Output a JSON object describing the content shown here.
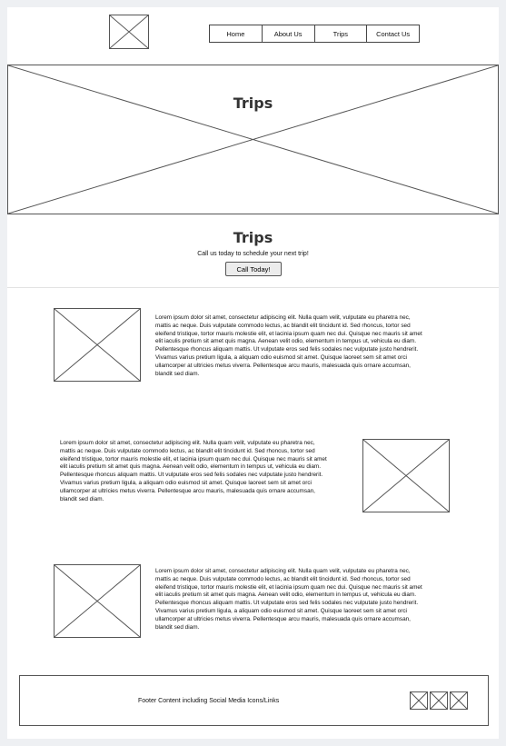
{
  "nav": {
    "items": [
      {
        "label": "Home"
      },
      {
        "label": "About Us"
      },
      {
        "label": "Trips"
      },
      {
        "label": "Contact Us"
      }
    ]
  },
  "hero": {
    "title": "Trips"
  },
  "cta": {
    "title": "Trips",
    "text": "Call us today to schedule your next trip!",
    "button_label": "Call Today!"
  },
  "content": {
    "rows": [
      {
        "text": "Lorem ipsum dolor sit amet, consectetur adipiscing elit. Nulla quam velit, vulputate eu pharetra nec, mattis ac neque. Duis vulputate commodo lectus, ac blandit elit tincidunt id. Sed rhoncus, tortor sed eleifend tristique, tortor mauris molestie elit, et lacinia ipsum quam nec dui. Quisque nec mauris sit amet elit iaculis pretium sit amet quis magna. Aenean velit odio, elementum in tempus ut, vehicula eu diam. Pellentesque rhoncus aliquam mattis. Ut vulputate eros sed felis sodales nec vulputate justo hendrerit. Vivamus varius pretium ligula, a aliquam odio euismod sit amet. Quisque laoreet sem sit amet orci ullamcorper at ultricies metus viverra. Pellentesque arcu mauris, malesuada quis ornare accumsan, blandit sed diam."
      },
      {
        "text": "Lorem ipsum dolor sit amet, consectetur adipiscing elit. Nulla quam velit, vulputate eu pharetra nec, mattis ac neque. Duis vulputate commodo lectus, ac blandit elit tincidunt id. Sed rhoncus, tortor sed eleifend tristique, tortor mauris molestie elit, et lacinia ipsum quam nec dui. Quisque nec mauris sit amet elit iaculis pretium sit amet quis magna. Aenean velit odio, elementum in tempus ut, vehicula eu diam. Pellentesque rhoncus aliquam mattis. Ut vulputate eros sed felis sodales nec vulputate justo hendrerit. Vivamus varius pretium ligula, a aliquam odio euismod sit amet. Quisque laoreet sem sit amet orci ullamcorper at ultricies metus viverra. Pellentesque arcu mauris, malesuada quis ornare accumsan, blandit sed diam."
      },
      {
        "text": "Lorem ipsum dolor sit amet, consectetur adipiscing elit. Nulla quam velit, vulputate eu pharetra nec, mattis ac neque. Duis vulputate commodo lectus, ac blandit elit tincidunt id. Sed rhoncus, tortor sed eleifend tristique, tortor mauris molestie elit, et lacinia ipsum quam nec dui. Quisque nec mauris sit amet elit iaculis pretium sit amet quis magna. Aenean velit odio, elementum in tempus ut, vehicula eu diam. Pellentesque rhoncus aliquam mattis. Ut vulputate eros sed felis sodales nec vulputate justo hendrerit. Vivamus varius pretium ligula, a aliquam odio euismod sit amet. Quisque laoreet sem sit amet orci ullamcorper at ultricies metus viverra. Pellentesque arcu mauris, malesuada quis ornare accumsan, blandit sed diam."
      }
    ]
  },
  "footer": {
    "text": "Footer Content including Social Media Icons/Links",
    "social_icons": [
      "social-media-icon",
      "social-media-icon",
      "social-media-icon"
    ]
  },
  "placeholder_icon": "image-placeholder-icon",
  "colors": {
    "background": "#eef0f3",
    "page": "#ffffff",
    "stroke": "#555555",
    "button": "#ececec"
  }
}
